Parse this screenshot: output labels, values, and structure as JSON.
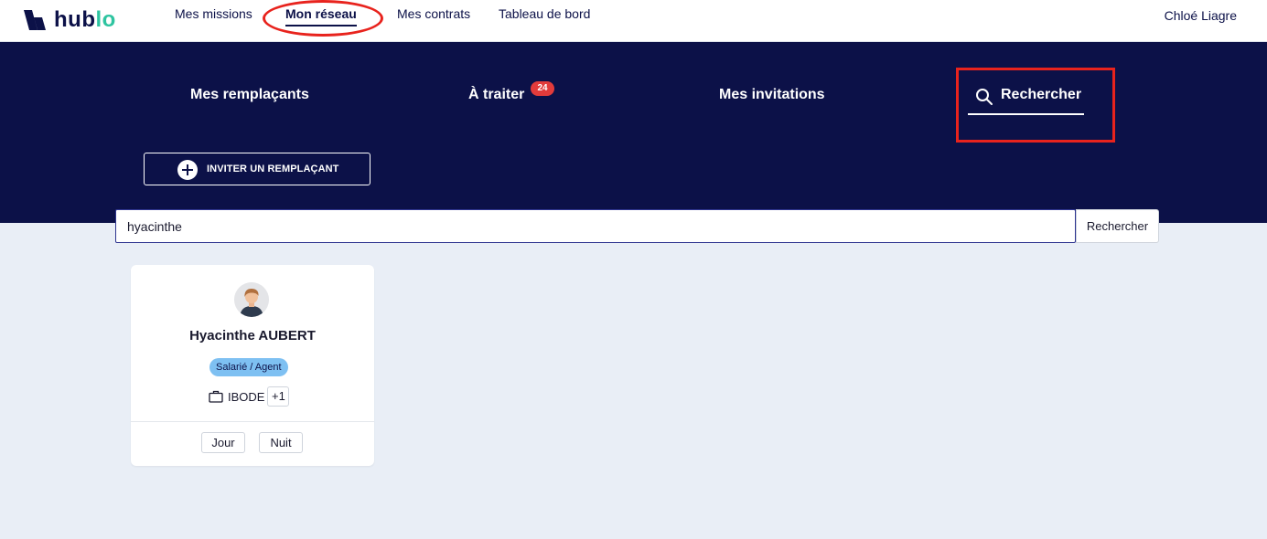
{
  "app": {
    "logo_text_a": "hub",
    "logo_text_b": "lo",
    "brand_navy": "#0c1148",
    "brand_green": "#2ec4a0"
  },
  "topnav": {
    "items": [
      {
        "label": "Mes missions",
        "active": false
      },
      {
        "label": "Mon réseau",
        "active": true
      },
      {
        "label": "Mes contrats",
        "active": false
      },
      {
        "label": "Tableau de bord",
        "active": false
      }
    ],
    "user_name": "Chloé Liagre"
  },
  "subnav": {
    "tabs": [
      {
        "label": "Mes remplaçants"
      },
      {
        "label": "À traiter",
        "badge": "24"
      },
      {
        "label": "Mes invitations"
      },
      {
        "label": "Rechercher",
        "icon": "search-icon",
        "active": true
      }
    ],
    "invite_button_label": "INVITER UN REMPLAÇANT"
  },
  "search": {
    "value": "hyacinthe",
    "button_label": "Rechercher"
  },
  "results": [
    {
      "name": "Hyacinthe AUBERT",
      "type": "Salarié / Agent",
      "job": "IBODE",
      "more": "+1",
      "shifts": [
        "Jour",
        "Nuit"
      ]
    }
  ],
  "annotations": {
    "highlight_color": "#e8231d"
  }
}
